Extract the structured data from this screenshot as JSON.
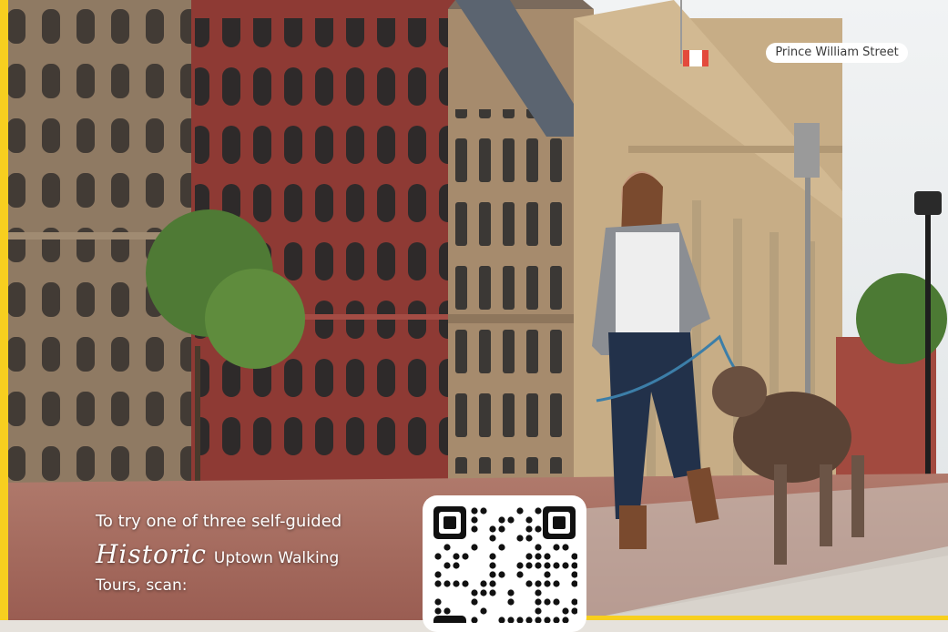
{
  "photo": {
    "caption": "Prince William Street"
  },
  "promo": {
    "line1": "To try one of three self-guided",
    "script_word": "Historic",
    "line2_rest": "Uptown Walking",
    "line3": "Tours, scan:"
  },
  "qr": {
    "icon": "qr-code-icon"
  },
  "colors": {
    "brand_yellow": "#f7cf1f",
    "sky": "#e9ecee",
    "red_building": "#9a3e38",
    "sandstone": "#a78a6a",
    "brick_path": "#a76a5e"
  }
}
